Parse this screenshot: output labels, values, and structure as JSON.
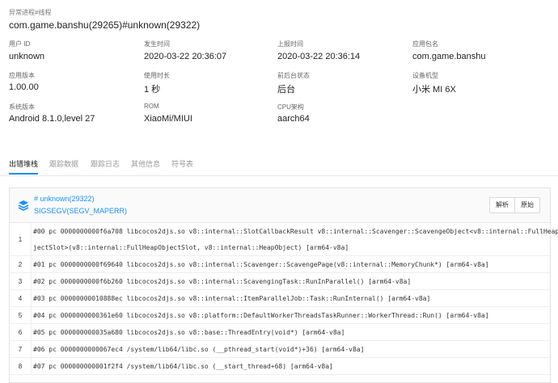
{
  "header": {
    "section_label": "异常进程#线程",
    "title": "com.game.banshu(29265)#unknown(29322)"
  },
  "fields": {
    "user_id": {
      "label": "用户 ID",
      "value": "unknown"
    },
    "occur_time": {
      "label": "发生时间",
      "value": "2020-03-22 20:36:07"
    },
    "report_time": {
      "label": "上报时间",
      "value": "2020-03-22 20:36:14"
    },
    "package": {
      "label": "应用包名",
      "value": "com.game.banshu"
    },
    "app_version": {
      "label": "应用版本",
      "value": "1.00.00"
    },
    "duration": {
      "label": "使用时长",
      "value": "1 秒"
    },
    "fg_bg": {
      "label": "前后台状态",
      "value": "后台"
    },
    "device": {
      "label": "设备机型",
      "value": "小米 MI 6X"
    },
    "os_version": {
      "label": "系统版本",
      "value": "Android 8.1.0,level 27"
    },
    "rom": {
      "label": "ROM",
      "value": "XiaoMi/MIUI"
    },
    "cpu": {
      "label": "CPU架构",
      "value": "aarch64"
    }
  },
  "tabs": [
    {
      "label": "出错堆栈",
      "active": true
    },
    {
      "label": "跟踪数据",
      "active": false
    },
    {
      "label": "跟踪日志",
      "active": false
    },
    {
      "label": "其他信息",
      "active": false
    },
    {
      "label": "符号表",
      "active": false
    }
  ],
  "stack_panel": {
    "icon": "layers-icon",
    "thread": "# unknown(29322)",
    "signal": "SIGSEGV(SEGV_MAPERR)",
    "buttons": {
      "parse": "解析",
      "raw": "原始"
    },
    "accent_color": "#1890ff",
    "rows": [
      {
        "num": "1",
        "line1": "#00 pc 0000000000f6a708 libcocos2djs.so v8::internal::SlotCallbackResult v8::internal::Scavenger::ScavengeObject<v8::internal::FullHeapOb",
        "line2": "jectSlot>(v8::internal::FullHeapObjectSlot, v8::internal::HeapObject) [arm64-v8a]"
      },
      {
        "num": "2",
        "line1": "#01 pc 0000000000f69640 libcocos2djs.so v8::internal::Scavenger::ScavengePage(v8::internal::MemoryChunk*) [arm64-v8a]"
      },
      {
        "num": "3",
        "line1": "#02 pc 0000000000f6b260 libcocos2djs.so v8::internal::ScavengingTask::RunInParallel() [arm64-v8a]"
      },
      {
        "num": "4",
        "line1": "#03 pc 00000000010888ec libcocos2djs.so v8::internal::ItemParallelJob::Task::RunInternal() [arm64-v8a]"
      },
      {
        "num": "5",
        "line1": "#04 pc 0000000000361e60 libcocos2djs.so v8::platform::DefaultWorkerThreadsTaskRunner::WorkerThread::Run() [arm64-v8a]"
      },
      {
        "num": "6",
        "line1": "#05 pc 000000000035a680 libcocos2djs.so v8::base::ThreadEntry(void*) [arm64-v8a]"
      },
      {
        "num": "7",
        "line1": "#06 pc 0000000000067ec4 /system/lib64/libc.so (__pthread_start(void*)+36) [arm64-v8a]"
      },
      {
        "num": "8",
        "line1": "#07 pc 000000000001f2f4 /system/lib64/libc.so (__start_thread+68) [arm64-v8a]"
      }
    ]
  }
}
